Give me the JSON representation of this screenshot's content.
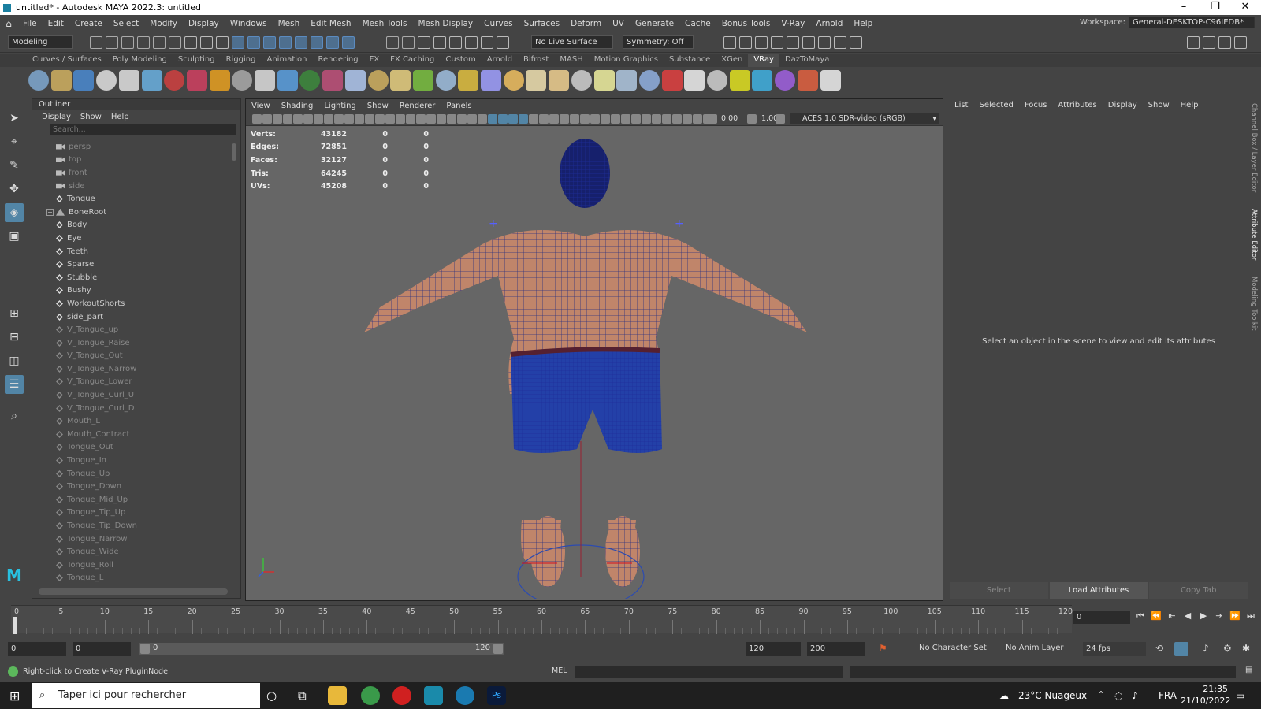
{
  "window": {
    "title": "untitled* - Autodesk MAYA 2022.3: untitled"
  },
  "menus": [
    "File",
    "Edit",
    "Create",
    "Select",
    "Modify",
    "Display",
    "Windows",
    "Mesh",
    "Edit Mesh",
    "Mesh Tools",
    "Mesh Display",
    "Curves",
    "Surfaces",
    "Deform",
    "UV",
    "Generate",
    "Cache",
    "Bonus Tools",
    "V-Ray",
    "Arnold",
    "Help"
  ],
  "workspace": {
    "label": "Workspace:",
    "value": "General-DESKTOP-C96IEDB*"
  },
  "statusline": {
    "mode": "Modeling",
    "live_surface": "No Live Surface",
    "symmetry": "Symmetry: Off"
  },
  "shelf_tabs": [
    "Curves / Surfaces",
    "Poly Modeling",
    "Sculpting",
    "Rigging",
    "Animation",
    "Rendering",
    "FX",
    "FX Caching",
    "Custom",
    "Arnold",
    "Bifrost",
    "MASH",
    "Motion Graphics",
    "Substance",
    "XGen",
    "VRay",
    "DazToMaya"
  ],
  "shelf_active": "VRay",
  "outliner": {
    "title": "Outliner",
    "menu": [
      "Display",
      "Show",
      "Help"
    ],
    "search_placeholder": "Search...",
    "items": [
      {
        "label": "persp",
        "type": "cam",
        "dim": true
      },
      {
        "label": "top",
        "type": "cam",
        "dim": true
      },
      {
        "label": "front",
        "type": "cam",
        "dim": true
      },
      {
        "label": "side",
        "type": "cam",
        "dim": true
      },
      {
        "label": "Tongue",
        "type": "mesh",
        "dim": false
      },
      {
        "label": "BoneRoot",
        "type": "joint",
        "dim": false,
        "expand": true
      },
      {
        "label": "Body",
        "type": "mesh",
        "dim": false
      },
      {
        "label": "Eye",
        "type": "mesh",
        "dim": false
      },
      {
        "label": "Teeth",
        "type": "mesh",
        "dim": false
      },
      {
        "label": "Sparse",
        "type": "mesh",
        "dim": false
      },
      {
        "label": "Stubble",
        "type": "mesh",
        "dim": false
      },
      {
        "label": "Bushy",
        "type": "mesh",
        "dim": false
      },
      {
        "label": "WorkoutShorts",
        "type": "mesh",
        "dim": false
      },
      {
        "label": "side_part",
        "type": "mesh",
        "dim": false
      },
      {
        "label": "V_Tongue_up",
        "type": "mesh",
        "dim": true
      },
      {
        "label": "V_Tongue_Raise",
        "type": "mesh",
        "dim": true
      },
      {
        "label": "V_Tongue_Out",
        "type": "mesh",
        "dim": true
      },
      {
        "label": "V_Tongue_Narrow",
        "type": "mesh",
        "dim": true
      },
      {
        "label": "V_Tongue_Lower",
        "type": "mesh",
        "dim": true
      },
      {
        "label": "V_Tongue_Curl_U",
        "type": "mesh",
        "dim": true
      },
      {
        "label": "V_Tongue_Curl_D",
        "type": "mesh",
        "dim": true
      },
      {
        "label": "Mouth_L",
        "type": "mesh",
        "dim": true
      },
      {
        "label": "Mouth_Contract",
        "type": "mesh",
        "dim": true
      },
      {
        "label": "Tongue_Out",
        "type": "mesh",
        "dim": true
      },
      {
        "label": "Tongue_In",
        "type": "mesh",
        "dim": true
      },
      {
        "label": "Tongue_Up",
        "type": "mesh",
        "dim": true
      },
      {
        "label": "Tongue_Down",
        "type": "mesh",
        "dim": true
      },
      {
        "label": "Tongue_Mid_Up",
        "type": "mesh",
        "dim": true
      },
      {
        "label": "Tongue_Tip_Up",
        "type": "mesh",
        "dim": true
      },
      {
        "label": "Tongue_Tip_Down",
        "type": "mesh",
        "dim": true
      },
      {
        "label": "Tongue_Narrow",
        "type": "mesh",
        "dim": true
      },
      {
        "label": "Tongue_Wide",
        "type": "mesh",
        "dim": true
      },
      {
        "label": "Tongue_Roll",
        "type": "mesh",
        "dim": true
      },
      {
        "label": "Tongue_L",
        "type": "mesh",
        "dim": true
      }
    ]
  },
  "viewport": {
    "menu": [
      "View",
      "Shading",
      "Lighting",
      "Show",
      "Renderer",
      "Panels"
    ],
    "exposure": "0.00",
    "gamma": "1.00",
    "color_space": "ACES 1.0 SDR-video (sRGB)",
    "hud": [
      {
        "label": "Verts:",
        "value": "43182",
        "a": "0",
        "b": "0"
      },
      {
        "label": "Edges:",
        "value": "72851",
        "a": "0",
        "b": "0"
      },
      {
        "label": "Faces:",
        "value": "32127",
        "a": "0",
        "b": "0"
      },
      {
        "label": "Tris:",
        "value": "64245",
        "a": "0",
        "b": "0"
      },
      {
        "label": "UVs:",
        "value": "45208",
        "a": "0",
        "b": "0"
      }
    ]
  },
  "attribute_editor": {
    "menu": [
      "List",
      "Selected",
      "Focus",
      "Attributes",
      "Display",
      "Show",
      "Help"
    ],
    "message": "Select an object in the scene to view and edit its attributes",
    "buttons": [
      "Select",
      "Load Attributes",
      "Copy Tab"
    ],
    "side_tabs": [
      "Channel Box / Layer Editor",
      "Attribute Editor",
      "Modeling Toolkit"
    ]
  },
  "timeline": {
    "ticks": [
      "5",
      "10",
      "15",
      "20",
      "25",
      "30",
      "35",
      "40",
      "45",
      "50",
      "55",
      "60",
      "65",
      "70",
      "75",
      "80",
      "85",
      "90",
      "95",
      "100",
      "105",
      "110",
      "115",
      "120"
    ],
    "current_frame": "0",
    "start_marker": "0"
  },
  "range": {
    "start": "0",
    "anim_start": "0",
    "slider_start": "0",
    "slider_end": "120",
    "playback_end": "120",
    "anim_end": "200",
    "character_set": "No Character Set",
    "anim_layer": "No Anim Layer",
    "fps": "24 fps"
  },
  "command": {
    "help": "Right-click to Create V-Ray PluginNode",
    "lang": "MEL"
  },
  "taskbar": {
    "search_placeholder": "Taper ici pour rechercher",
    "weather": "23°C Nuageux",
    "lang": "FRA",
    "time": "21:35",
    "date": "21/10/2022"
  }
}
